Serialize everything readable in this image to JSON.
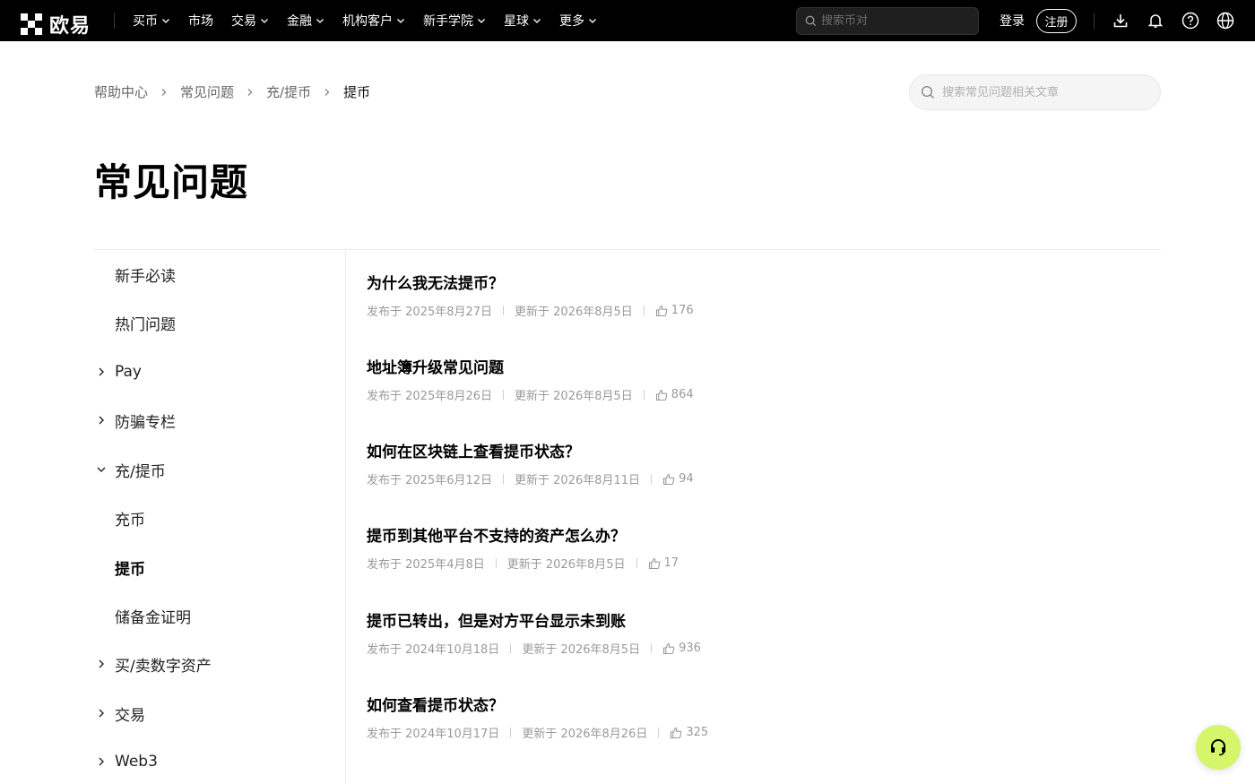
{
  "brand": {
    "name": "欧易"
  },
  "nav": {
    "items": [
      {
        "label": "买币",
        "dropdown": true
      },
      {
        "label": "市场",
        "dropdown": false
      },
      {
        "label": "交易",
        "dropdown": true
      },
      {
        "label": "金融",
        "dropdown": true
      },
      {
        "label": "机构客户",
        "dropdown": true
      },
      {
        "label": "新手学院",
        "dropdown": true
      },
      {
        "label": "星球",
        "dropdown": true
      },
      {
        "label": "更多",
        "dropdown": true
      }
    ],
    "search_placeholder": "搜索币对",
    "login_label": "登录",
    "register_label": "注册",
    "icons": [
      "download-icon",
      "bell-icon",
      "help-icon",
      "globe-icon"
    ]
  },
  "breadcrumb": [
    "帮助中心",
    "常见问题",
    "充/提币",
    "提币"
  ],
  "faq_search": {
    "placeholder": "搜索常见问题相关文章"
  },
  "page_title": "常见问题",
  "sidebar": {
    "items": [
      {
        "label": "新手必读",
        "chevron": "none",
        "active": false
      },
      {
        "label": "热门问题",
        "chevron": "none",
        "active": false
      },
      {
        "label": "Pay",
        "chevron": "right",
        "active": false
      },
      {
        "label": "防骗专栏",
        "chevron": "right",
        "active": false
      },
      {
        "label": "充/提币",
        "chevron": "down",
        "active": false
      },
      {
        "label": "充币",
        "chevron": "none",
        "active": false
      },
      {
        "label": "提币",
        "chevron": "none",
        "active": true
      },
      {
        "label": "储备金证明",
        "chevron": "none",
        "active": false
      },
      {
        "label": "买/卖数字资产",
        "chevron": "right",
        "active": false
      },
      {
        "label": "交易",
        "chevron": "right",
        "active": false
      },
      {
        "label": "Web3",
        "chevron": "right",
        "active": false
      }
    ]
  },
  "articles": [
    {
      "title": "为什么我无法提币？",
      "published": "发布于 2025年8月27日",
      "updated": "更新于 2026年8月5日",
      "likes": "176"
    },
    {
      "title": "地址簿升级常见问题",
      "published": "发布于 2025年8月26日",
      "updated": "更新于 2026年8月5日",
      "likes": "864"
    },
    {
      "title": "如何在区块链上查看提币状态？",
      "published": "发布于 2025年6月12日",
      "updated": "更新于 2026年8月11日",
      "likes": "94"
    },
    {
      "title": "提币到其他平台不支持的资产怎么办？",
      "published": "发布于 2025年4月8日",
      "updated": "更新于 2026年8月5日",
      "likes": "17"
    },
    {
      "title": "提币已转出，但是对方平台显示未到账",
      "published": "发布于 2024年10月18日",
      "updated": "更新于 2026年8月5日",
      "likes": "936"
    },
    {
      "title": "如何查看提币状态？",
      "published": "发布于 2024年10月17日",
      "updated": "更新于 2026年8月26日",
      "likes": "325"
    }
  ],
  "colors": {
    "nav_bg": "#000000",
    "accent": "#d5f56a",
    "muted": "#9a9a9a"
  },
  "support": {
    "icon": "headset-icon"
  }
}
